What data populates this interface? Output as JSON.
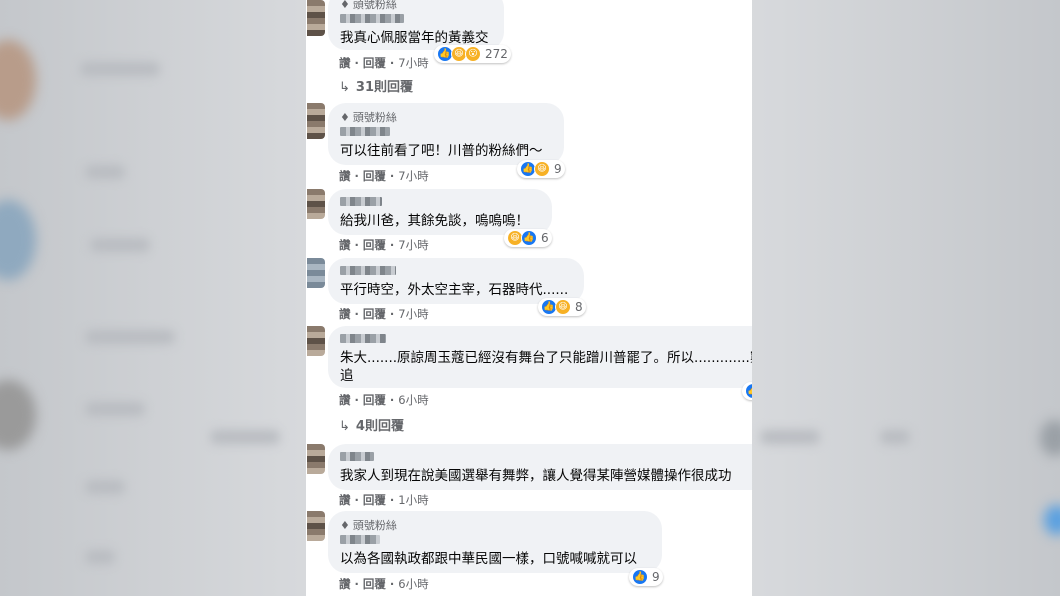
{
  "fan_badge": "頭號粉絲",
  "comments": [
    {
      "fan": true,
      "text": "我真心佩服當年的黃義交",
      "reactions": [
        "like",
        "haha",
        "wow"
      ],
      "reaction_count": "272",
      "like_label": "讚",
      "reply_label": "回覆",
      "time": "7小時",
      "replies_label": "31則回覆"
    },
    {
      "fan": true,
      "text": "可以往前看了吧！川普的粉絲們～",
      "reactions": [
        "like",
        "haha"
      ],
      "reaction_count": "9",
      "like_label": "讚",
      "reply_label": "回覆",
      "time": "7小時"
    },
    {
      "fan": false,
      "text": "給我川爸，其餘免談，嗚嗚嗚！",
      "reactions": [
        "haha",
        "like"
      ],
      "reaction_count": "6",
      "like_label": "讚",
      "reply_label": "回覆",
      "time": "7小時"
    },
    {
      "fan": false,
      "text": "平行時空，外太空主宰，石器時代......",
      "reactions": [
        "like",
        "haha"
      ],
      "reaction_count": "8",
      "like_label": "讚",
      "reply_label": "回覆",
      "time": "7小時"
    },
    {
      "fan": false,
      "text": "朱大.......原諒周玉蔻已經沒有舞台了只能蹭川普罷了。所以.............窮",
      "text2": "追",
      "reactions": [
        "like"
      ],
      "reaction_count": "",
      "like_label": "讚",
      "reply_label": "回覆",
      "time": "6小時",
      "replies_label": "4則回覆"
    },
    {
      "fan": false,
      "text": "我家人到現在說美國選舉有舞弊，讓人覺得某陣營媒體操作很成功",
      "reactions": [],
      "reaction_count": "",
      "like_label": "讚",
      "reply_label": "回覆",
      "time": "1小時"
    },
    {
      "fan": true,
      "text": "以為各國執政都跟中華民國一樣，口號喊喊就可以",
      "reactions": [
        "like"
      ],
      "reaction_count": "9",
      "like_label": "讚",
      "reply_label": "回覆",
      "time": "6小時"
    }
  ],
  "colors": {
    "bubble": "#f0f2f5",
    "secondary_text": "#65676b",
    "like_blue": "#1877f2",
    "haha_yellow": "#f7b125"
  }
}
